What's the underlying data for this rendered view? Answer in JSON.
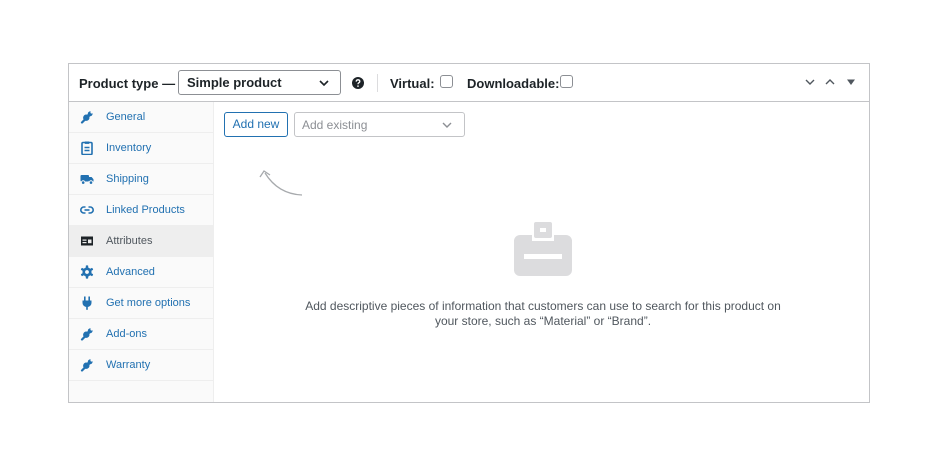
{
  "header": {
    "product_type_label": "Product type —",
    "product_type_value": "Simple product",
    "virtual_label": "Virtual:",
    "virtual_checked": false,
    "downloadable_label": "Downloadable:",
    "downloadable_checked": false
  },
  "sidebar": {
    "items": [
      {
        "label": "General",
        "icon": "wrench-icon",
        "active": false
      },
      {
        "label": "Inventory",
        "icon": "clipboard-icon",
        "active": false
      },
      {
        "label": "Shipping",
        "icon": "truck-icon",
        "active": false
      },
      {
        "label": "Linked Products",
        "icon": "link-icon",
        "active": false
      },
      {
        "label": "Attributes",
        "icon": "attributes-icon",
        "active": true
      },
      {
        "label": "Advanced",
        "icon": "gear-icon",
        "active": false
      },
      {
        "label": "Get more options",
        "icon": "plug-icon",
        "active": false
      },
      {
        "label": "Add-ons",
        "icon": "wrench-icon",
        "active": false
      },
      {
        "label": "Warranty",
        "icon": "wrench-icon",
        "active": false
      }
    ]
  },
  "main": {
    "add_new_label": "Add new",
    "add_existing_placeholder": "Add existing",
    "empty_message": "Add descriptive pieces of information that customers can use to search for this product on your store, such as “Material” or “Brand”."
  },
  "colors": {
    "link": "#2271b1",
    "active_tab_bg": "#eeeeee",
    "icon_dark": "#1d2327",
    "empty_icon": "#dcdcde"
  }
}
